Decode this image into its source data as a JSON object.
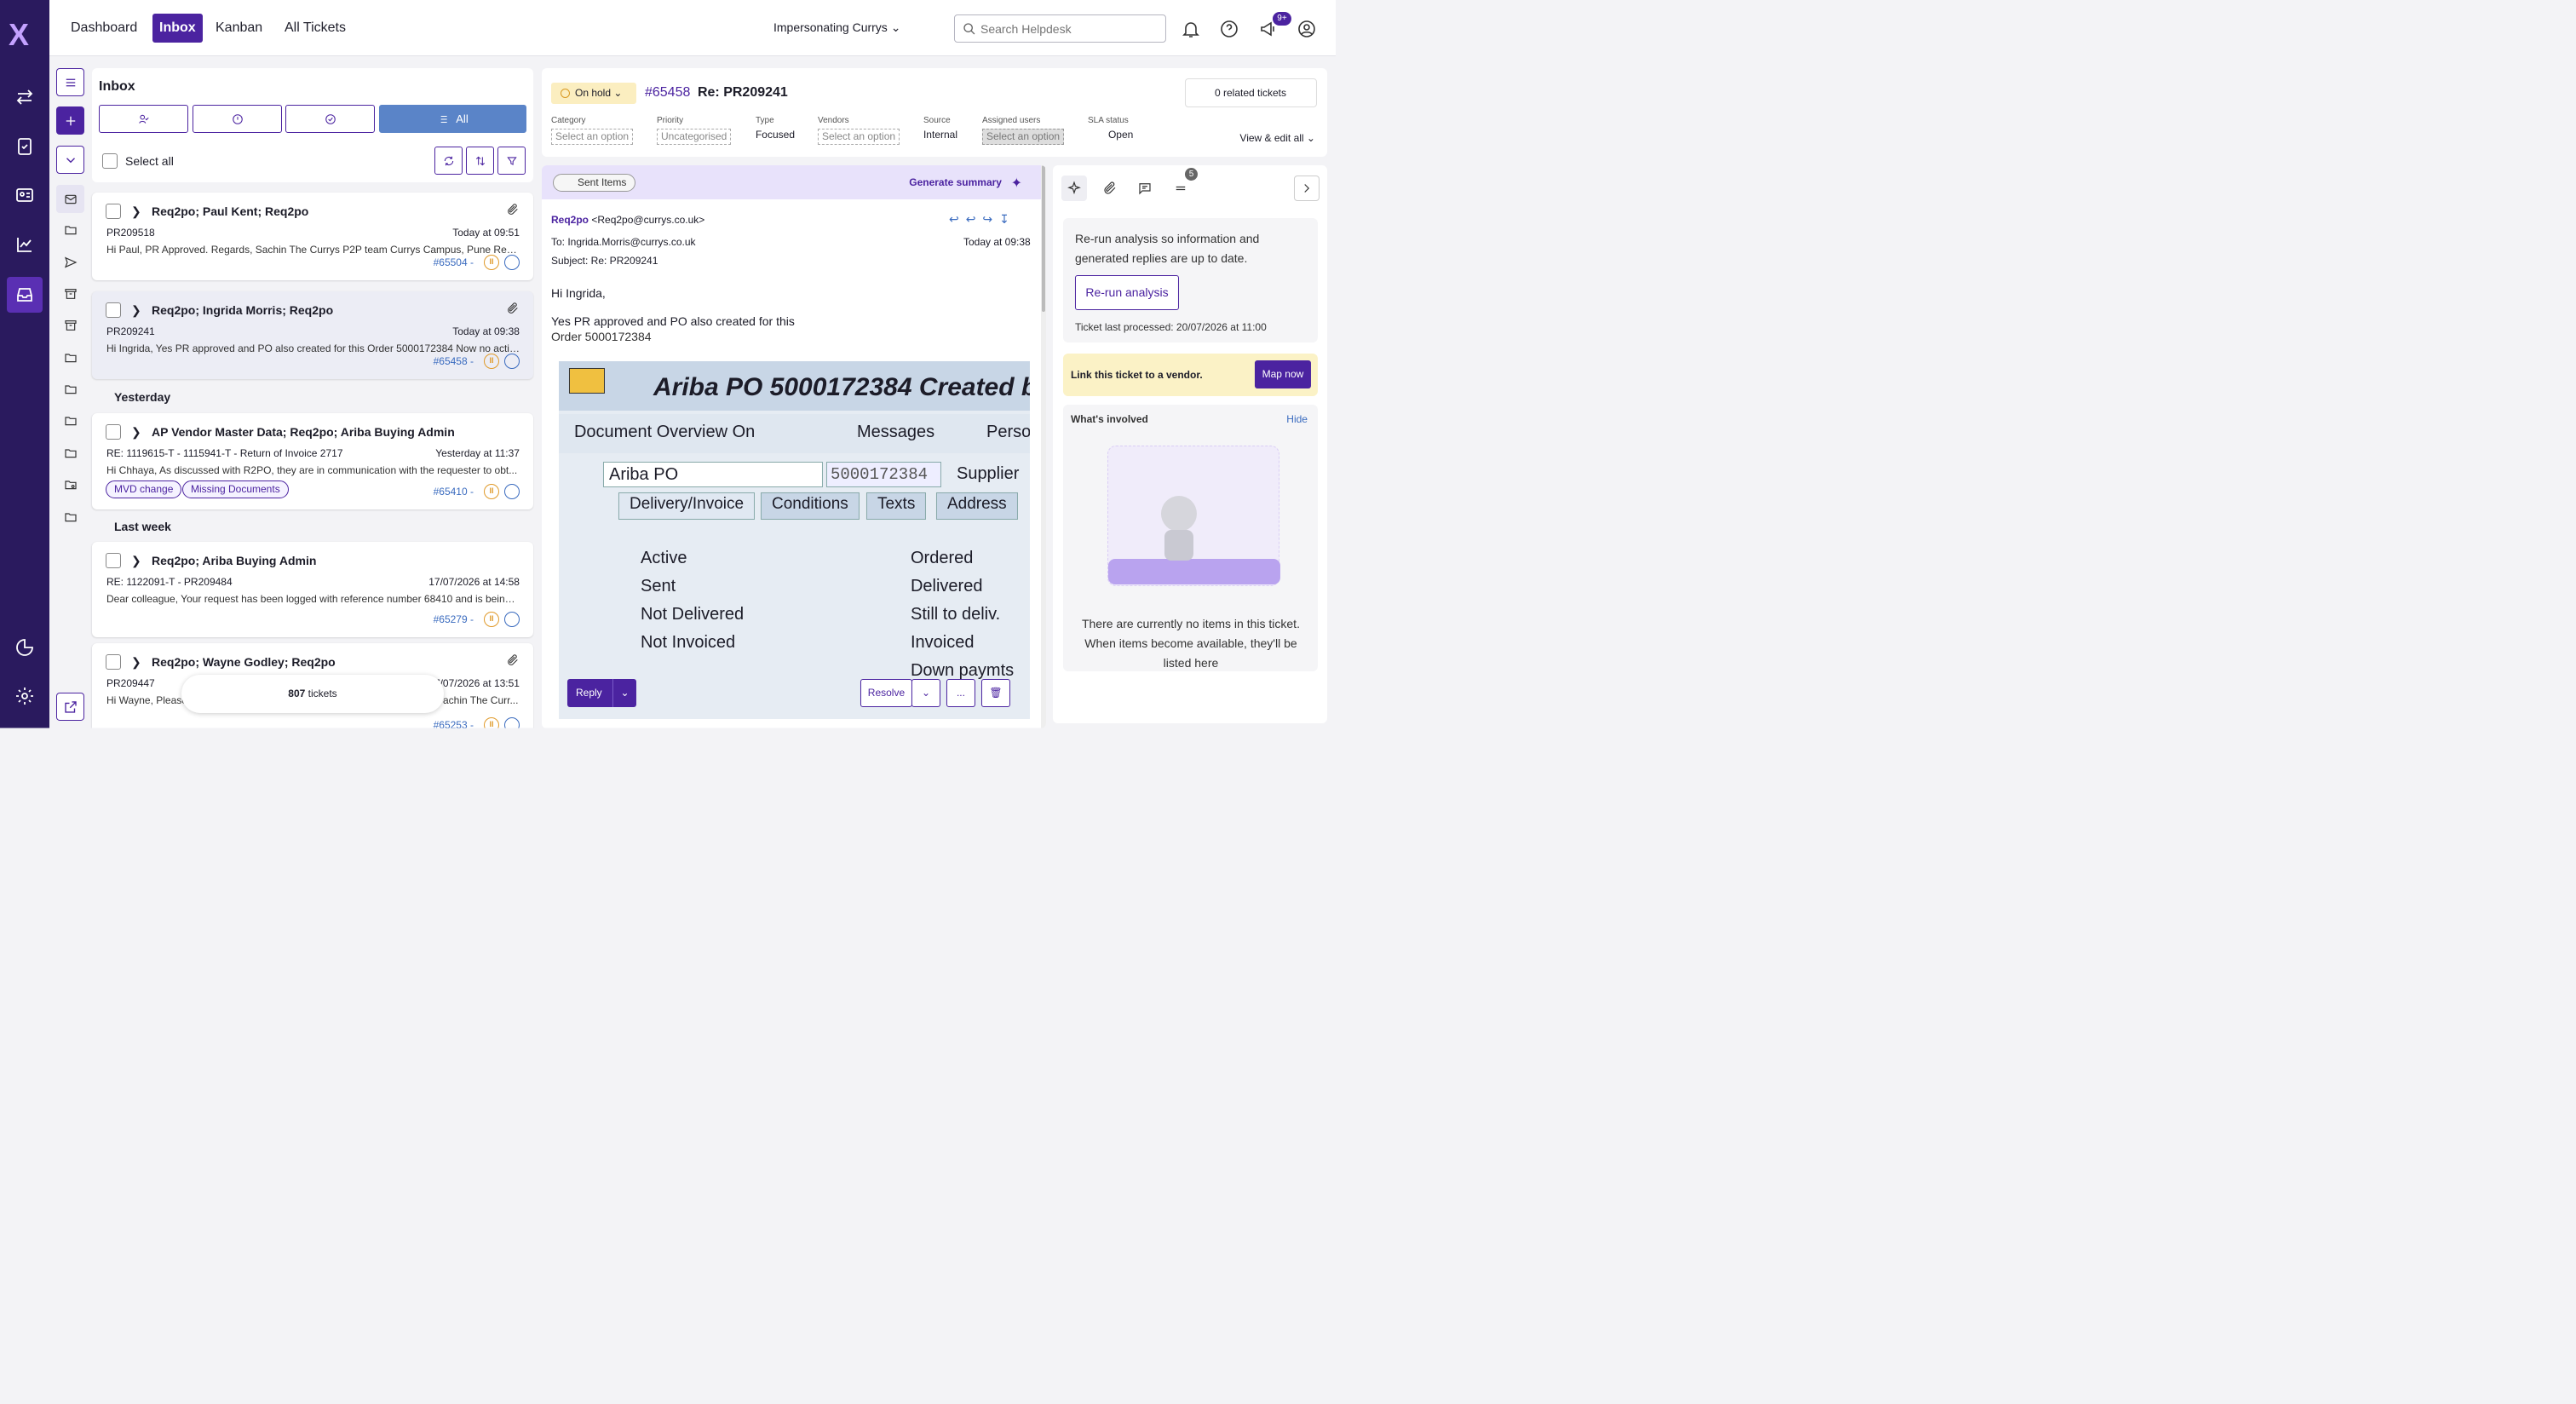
{
  "app": {
    "logo": "X"
  },
  "nav": {
    "items": [
      "Dashboard",
      "Inbox",
      "Kanban",
      "All Tickets"
    ],
    "active": "Inbox",
    "impersonating": "Impersonating Currys"
  },
  "search": {
    "placeholder": "Search Helpdesk"
  },
  "notifications": {
    "badge": "9+"
  },
  "inbox": {
    "title": "Inbox",
    "filter_all": "All",
    "select_all": "Select all",
    "groups": [
      "Yesterday",
      "Last week"
    ],
    "tickets": [
      {
        "title": "Req2po; Paul Kent; Req2po",
        "subject": "PR209518",
        "date": "Today at 09:51",
        "preview": "Hi Paul, PR Approved. Regards, Sachin The Currys P2P team Currys Campus, Pune Regist...",
        "id": "#65504 -"
      },
      {
        "title": "Req2po; Ingrida Morris; Req2po",
        "subject": "PR209241",
        "date": "Today at 09:38",
        "preview": "Hi Ingrida, Yes PR approved and PO also created for this Order 5000172384 Now no action ...",
        "id": "#65458 -"
      },
      {
        "title": "AP Vendor Master Data; Req2po; Ariba Buying Admin",
        "subject": "RE: 1119615-T - 1115941-T - Return of Invoice 2717",
        "date": "Yesterday at 11:37",
        "preview": "Hi Chhaya, As discussed with R2PO, they are in communication with the requester to obt...",
        "id": "#65410 -",
        "tags": [
          "MVD change",
          "Missing Documents"
        ]
      },
      {
        "title": "Req2po; Ariba Buying Admin",
        "subject": "RE: 1122091-T - PR209484",
        "date": "17/07/2026 at 14:58",
        "preview": "Dear colleague, Your request has been logged with reference number 68410 and is being r...",
        "id": "#65279 -"
      },
      {
        "title": "Req2po; Wayne Godley; Req2po",
        "subject": "PR209447",
        "date": "17/07/2026 at 13:51",
        "preview": "Hi Wayne, Please",
        "preview_tail": "achin The Curr...",
        "id": "#65253 -"
      }
    ],
    "count_num": "807",
    "count_label": "tickets"
  },
  "ticket": {
    "status": "On hold",
    "id": "#65458",
    "title": "Re: PR209241",
    "related": "0 related tickets",
    "fields": [
      {
        "label": "Category",
        "value": "Select an option"
      },
      {
        "label": "Priority",
        "value": "Uncategorised"
      },
      {
        "label": "Type",
        "value": "Focused"
      },
      {
        "label": "Vendors",
        "value": "Select an option"
      },
      {
        "label": "Source",
        "value": "Internal"
      },
      {
        "label": "Assigned users",
        "value": "Select an option"
      },
      {
        "label": "SLA status",
        "value": "Open"
      }
    ],
    "view_edit": "View & edit all"
  },
  "email": {
    "folder": "Sent Items",
    "generate": "Generate summary",
    "from_name": "Req2po",
    "from_addr": "<Req2po@currys.co.uk>",
    "to": "To: Ingrida.Morris@currys.co.uk",
    "date": "Today at 09:38",
    "subject": "Subject: Re: PR209241",
    "greeting": "Hi Ingrida,",
    "line1": "Yes PR approved and PO also created for this",
    "line2": "Order 5000172384",
    "shot": {
      "title": "Ariba PO 5000172384 Created b",
      "doc_overview": "Document Overview On",
      "messages": "Messages",
      "person": "Persor",
      "po_type": "Ariba PO",
      "po_num": "5000172384",
      "supplier": "Supplier",
      "tabs": [
        "Delivery/Invoice",
        "Conditions",
        "Texts",
        "Address"
      ],
      "left": [
        "Active",
        "Sent",
        "Not Delivered",
        "Not Invoiced"
      ],
      "right": [
        "Ordered",
        "Delivered",
        "Still to deliv.",
        "Invoiced",
        "Down paymts"
      ]
    },
    "reply": "Reply",
    "resolve": "Resolve",
    "more": "..."
  },
  "side": {
    "badge": "5",
    "rerun_text": "Re-run analysis so information and generated replies are up to date.",
    "rerun_btn": "Re-run analysis",
    "processed": "Ticket last processed: 20/07/2026 at 11:00",
    "vendor_text": "Link this ticket to a vendor.",
    "map_btn": "Map now",
    "involved": "What's involved",
    "hide": "Hide",
    "empty": "There are currently no items in this ticket. When items become available, they'll be listed here"
  }
}
